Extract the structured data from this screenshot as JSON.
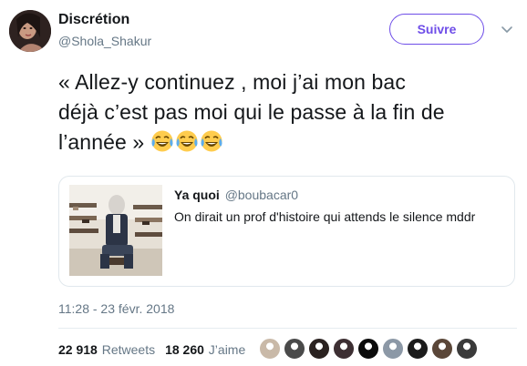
{
  "author": {
    "name": "Discrétion",
    "handle": "@Shola_Shakur"
  },
  "follow_button": {
    "label": "Suivre"
  },
  "tweet": {
    "lines": [
      "« Allez-y continuez , moi j’ai mon bac",
      "déjà c’est pas moi qui le passe à la fin de",
      "l’année  »"
    ],
    "emojis": [
      "face-with-tears-of-joy-icon",
      "face-with-tears-of-joy-icon",
      "face-with-tears-of-joy-icon"
    ]
  },
  "quote": {
    "name": "Ya quoi",
    "handle": "@boubacar0",
    "text": "On dirait un prof d'histoire qui attends le silence mddr"
  },
  "timestamp": "11:28 - 23 févr. 2018",
  "stats": {
    "retweets_count": "22 918",
    "retweets_label": "Retweets",
    "likes_count": "18 260",
    "likes_label": "J’aime"
  },
  "likers": {
    "colors": [
      "#c9b9a8",
      "#4a4a4a",
      "#2a2220",
      "#3d2f33",
      "#0b0b0b",
      "#8c98a6",
      "#1c1c1c",
      "#5a4638",
      "#3a3a3a"
    ]
  },
  "colors": {
    "accent": "#6e4de8",
    "secondary_text": "#657786",
    "border": "#e1e8ed"
  }
}
